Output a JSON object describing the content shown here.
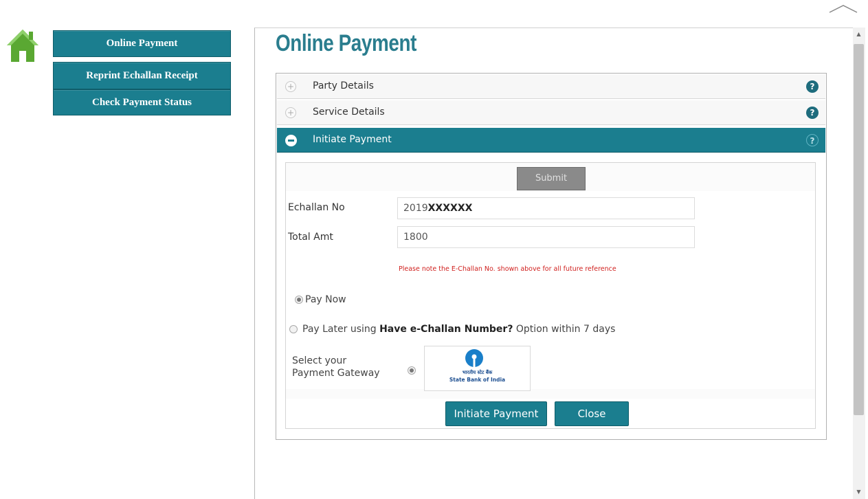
{
  "nav": {
    "items": [
      {
        "label": "Online Payment"
      },
      {
        "label": "Reprint Echallan Receipt"
      },
      {
        "label": "Check Payment Status"
      }
    ]
  },
  "page": {
    "title": "Online Payment"
  },
  "accordion": {
    "sections": [
      {
        "title": "Party Details",
        "state": "collapsed"
      },
      {
        "title": "Service Details",
        "state": "collapsed"
      },
      {
        "title": "Initiate Payment",
        "state": "expanded"
      }
    ],
    "help_symbol": "?"
  },
  "form": {
    "submit_label": "Submit",
    "echallan": {
      "label": "Echallan No",
      "value_prefix": "2019",
      "value_masked": "XXXXXX"
    },
    "total": {
      "label": "Total Amt",
      "value": "1800"
    },
    "note": "Please note the E-Challan No. shown above for all future reference",
    "pay_now": {
      "label": "Pay Now",
      "checked": true
    },
    "pay_later": {
      "prefix": "Pay Later using ",
      "bold": "Have e-Challan Number?",
      "suffix": " Option within 7 days",
      "checked": false
    },
    "gateway": {
      "label_line1": "Select your",
      "label_line2": "Payment Gateway",
      "option_hindi": "भारतीय स्टेट बैंक",
      "option_name": "State Bank of India"
    },
    "initiate_label": "Initiate Payment",
    "close_label": "Close"
  },
  "colors": {
    "accent": "#1b7e8f",
    "title": "#2a7d8e",
    "note": "#d0201e",
    "home_icon": "#5aa832"
  }
}
